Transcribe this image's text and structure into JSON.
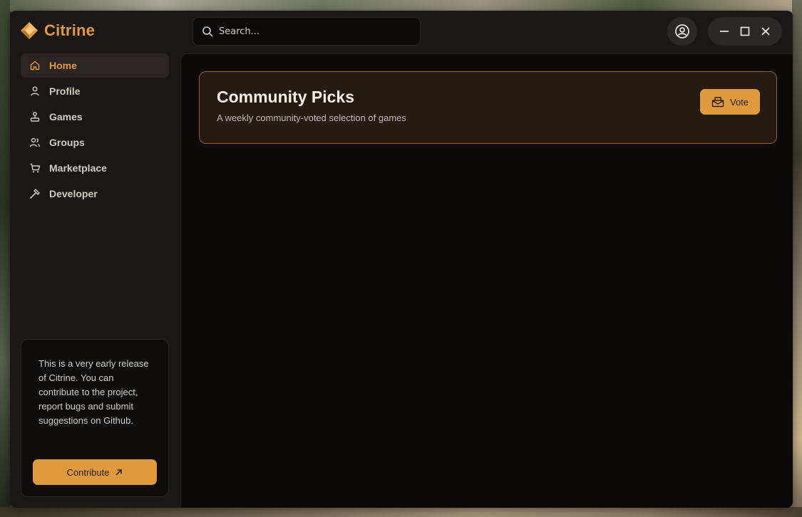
{
  "app": {
    "name": "Citrine"
  },
  "colors": {
    "accent": "#e09a3e",
    "sidebar_bg": "#1a1716",
    "main_bg": "#0b0a09",
    "banner_bg": "#241b13"
  },
  "search": {
    "placeholder": "Search..."
  },
  "sidebar": {
    "items": [
      {
        "label": "Home",
        "icon": "home-icon",
        "active": true
      },
      {
        "label": "Profile",
        "icon": "user-icon",
        "active": false
      },
      {
        "label": "Games",
        "icon": "joystick-icon",
        "active": false
      },
      {
        "label": "Groups",
        "icon": "users-icon",
        "active": false
      },
      {
        "label": "Marketplace",
        "icon": "cart-icon",
        "active": false
      },
      {
        "label": "Developer",
        "icon": "hammer-icon",
        "active": false
      }
    ],
    "info_card": {
      "text": "This is a very early release of Citrine. You can contribute to the project, report bugs and submit suggestions on Github.",
      "button_label": "Contribute"
    }
  },
  "main": {
    "banner": {
      "title": "Community Picks",
      "subtitle": "A weekly community-voted selection of games",
      "button_label": "Vote"
    }
  }
}
